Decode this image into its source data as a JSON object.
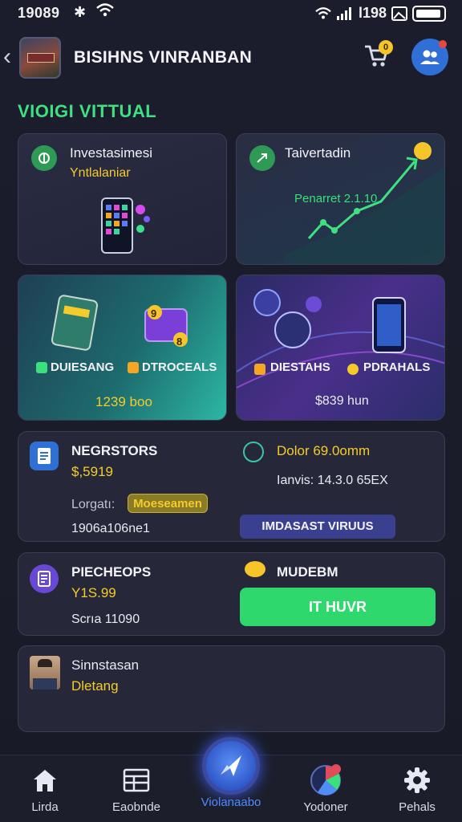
{
  "status_bar": {
    "time": "19089",
    "right_text": "l198"
  },
  "header": {
    "title": "BISIHNS VINRANBAN",
    "cart_badge": "0"
  },
  "section_title": "VIOIGI VITTUAL",
  "cards": {
    "c1": {
      "title": "Investasimesi",
      "subtitle": "Yntlalaniar"
    },
    "c2": {
      "title": "Taivertadin",
      "chart_label": "Penarret 2.1.10"
    },
    "c3": {
      "label_a": "DUIESANG",
      "label_b": "DTROCEALS",
      "amount": "1239 boo",
      "float_a": "9",
      "float_b": "8"
    },
    "c4": {
      "label_a": "DIESTAHS",
      "label_b": "PDRAHALS",
      "amount": "$839 hun"
    },
    "c5": {
      "title": "NEGRSTORS",
      "value": "$,5919",
      "label": "Lorgatı:",
      "pill": "Moeseamen",
      "code": "1906a106ne1",
      "right_title": "Dolor 69.0omm",
      "right_detail": "Ianvis: 14.3.0 65EX",
      "button": "IMDASAST VIRUUS"
    },
    "c6": {
      "title": "PIECHEOPS",
      "value": "Y1S.99",
      "sub": "Scrıa 11090",
      "right_title": "MUDEBM",
      "button": "IT HUVR"
    },
    "c7": {
      "name": "Sinnstasan",
      "sub": "Dletang"
    }
  },
  "nav": [
    {
      "label": "Lirda",
      "icon": "home-icon"
    },
    {
      "label": "Eaobnde",
      "icon": "table-icon"
    },
    {
      "label": "Violanaabo",
      "icon": "compass-icon"
    },
    {
      "label": "Yodoner",
      "icon": "pie-chart-icon"
    },
    {
      "label": "Pehals",
      "icon": "gear-icon"
    }
  ],
  "colors": {
    "accent_green": "#39e07b",
    "accent_yellow": "#f5cb2c",
    "primary_blue": "#2f6fd6"
  }
}
